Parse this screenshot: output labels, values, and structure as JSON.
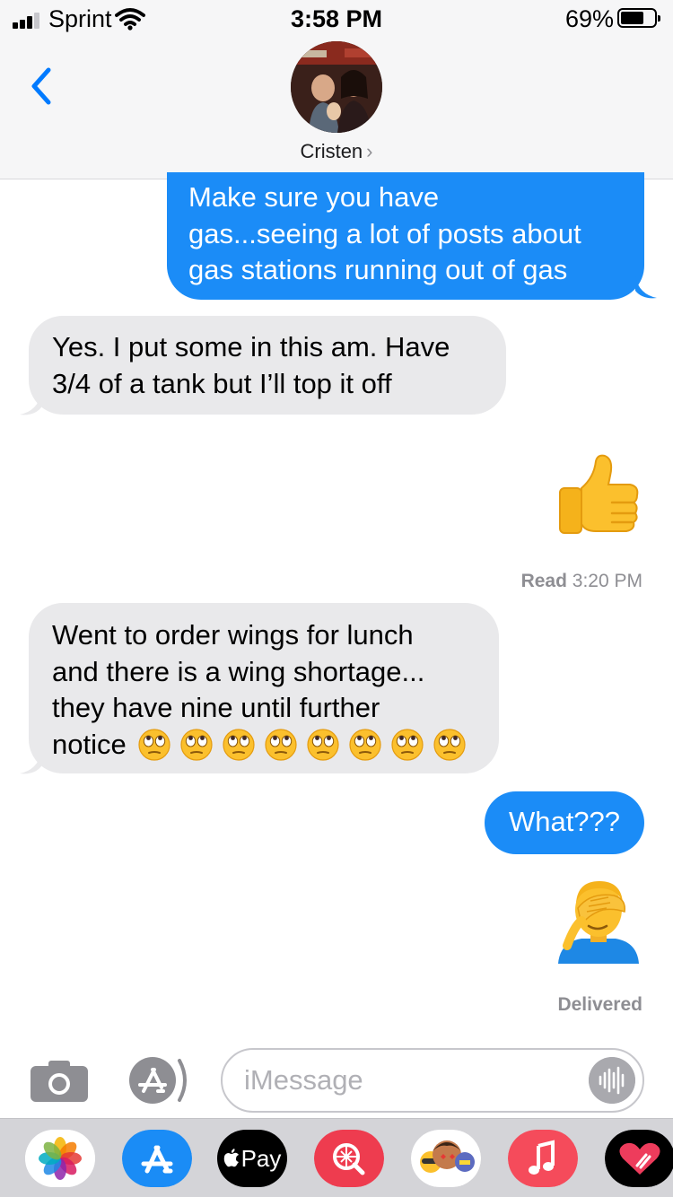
{
  "status_bar": {
    "carrier": "Sprint",
    "time": "3:58 PM",
    "battery_percent": "69%",
    "battery_level": 0.69,
    "signal_bars": 3
  },
  "header": {
    "contact_name": "Cristen",
    "chevron": "›"
  },
  "messages": [
    {
      "from": "me",
      "lines": [
        "Make sure you have",
        "gas...seeing a lot of posts about",
        "gas stations running out of gas"
      ]
    },
    {
      "from": "them",
      "lines": [
        "Yes. I put some in this am. Have",
        "3/4 of a tank but I’ll top it off"
      ]
    },
    {
      "from": "me",
      "emoji": "thumbs-up"
    },
    {
      "from": "me",
      "status_label": "Read",
      "status_time": "3:20 PM"
    },
    {
      "from": "them",
      "lines": [
        "Went to order wings for lunch",
        "and there is a wing shortage...",
        "they have nine until further",
        "notice"
      ],
      "trailing_emoji": "face-with-rolling-eyes",
      "trailing_emoji_count": 8
    },
    {
      "from": "me",
      "lines": [
        "What???"
      ]
    },
    {
      "from": "me",
      "emoji": "person-facepalming"
    },
    {
      "from": "me",
      "status_label": "Delivered"
    }
  ],
  "composer": {
    "placeholder": "iMessage"
  },
  "app_drawer": {
    "apps": [
      {
        "icon": "photos-icon"
      },
      {
        "icon": "app-store-icon"
      },
      {
        "icon": "apple-pay-icon",
        "label": "Pay"
      },
      {
        "icon": "web-images-icon"
      },
      {
        "icon": "memoji-stickers-icon"
      },
      {
        "icon": "music-icon"
      },
      {
        "icon": "digital-touch-icon"
      }
    ]
  },
  "colors": {
    "outgoing_bubble": "#1b8cf7",
    "incoming_bubble": "#e9e9eb",
    "accent": "#007aff"
  }
}
